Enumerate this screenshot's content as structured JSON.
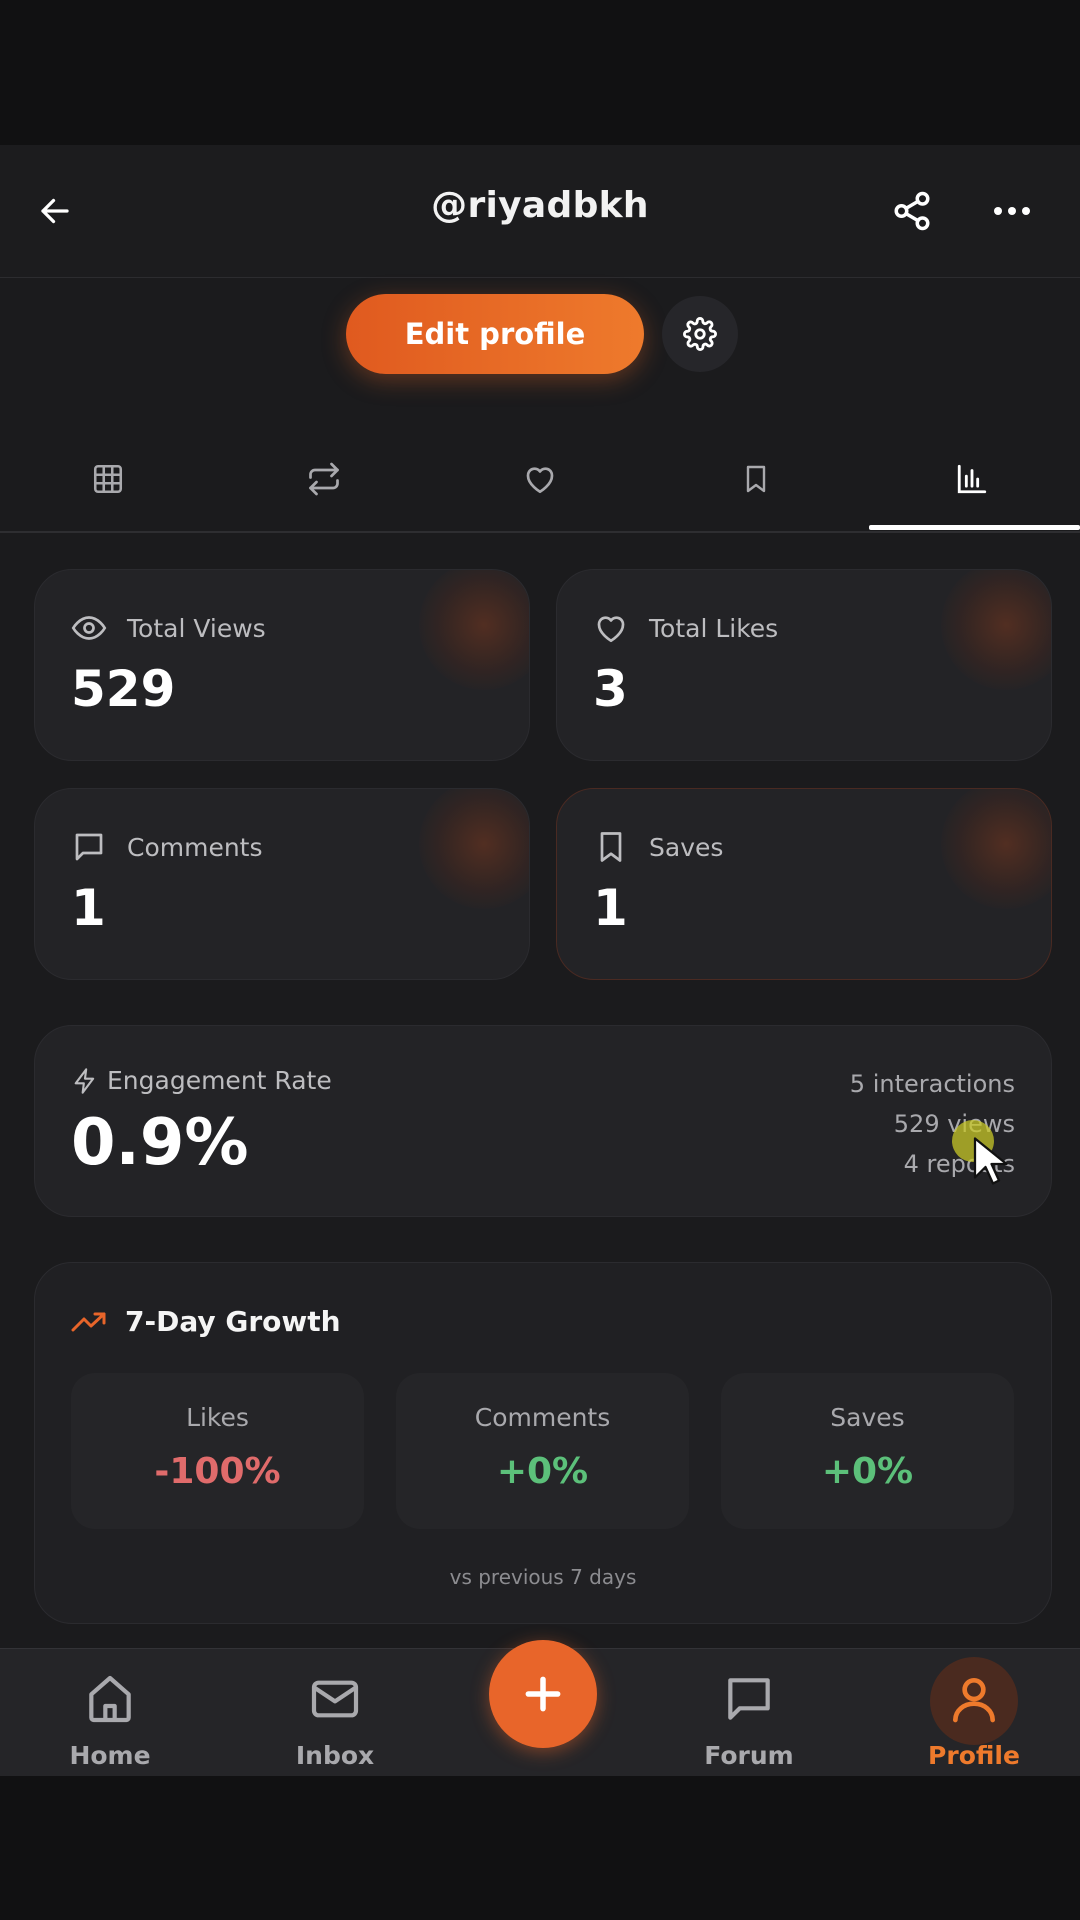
{
  "header": {
    "title": "@riyadbkh"
  },
  "profile_actions": {
    "edit_label": "Edit profile"
  },
  "tabs": [
    "grid",
    "reposts",
    "likes",
    "saved",
    "analytics"
  ],
  "stats": [
    {
      "label": "Total Views",
      "value": "529",
      "icon": "eye-icon"
    },
    {
      "label": "Total Likes",
      "value": "3",
      "icon": "heart-icon"
    },
    {
      "label": "Comments",
      "value": "1",
      "icon": "comment-icon"
    },
    {
      "label": "Saves",
      "value": "1",
      "icon": "bookmark-icon"
    }
  ],
  "engagement": {
    "label": "Engagement Rate",
    "value": "0.9%",
    "interactions": "5 interactions",
    "views": "529 views",
    "reposts": "4 reposts"
  },
  "growth": {
    "title": "7-Day Growth",
    "metrics": [
      {
        "label": "Likes",
        "value": "-100%",
        "color": "#e06b6b"
      },
      {
        "label": "Comments",
        "value": "+0%",
        "color": "#5cc07a"
      },
      {
        "label": "Saves",
        "value": "+0%",
        "color": "#5cc07a"
      }
    ],
    "note": "vs previous 7 days"
  },
  "nav": {
    "home": "Home",
    "inbox": "Inbox",
    "forum": "Forum",
    "profile": "Profile",
    "active": "profile"
  },
  "colors": {
    "accent": "#e8652a",
    "positive": "#5cc07a",
    "negative": "#e06b6b"
  }
}
